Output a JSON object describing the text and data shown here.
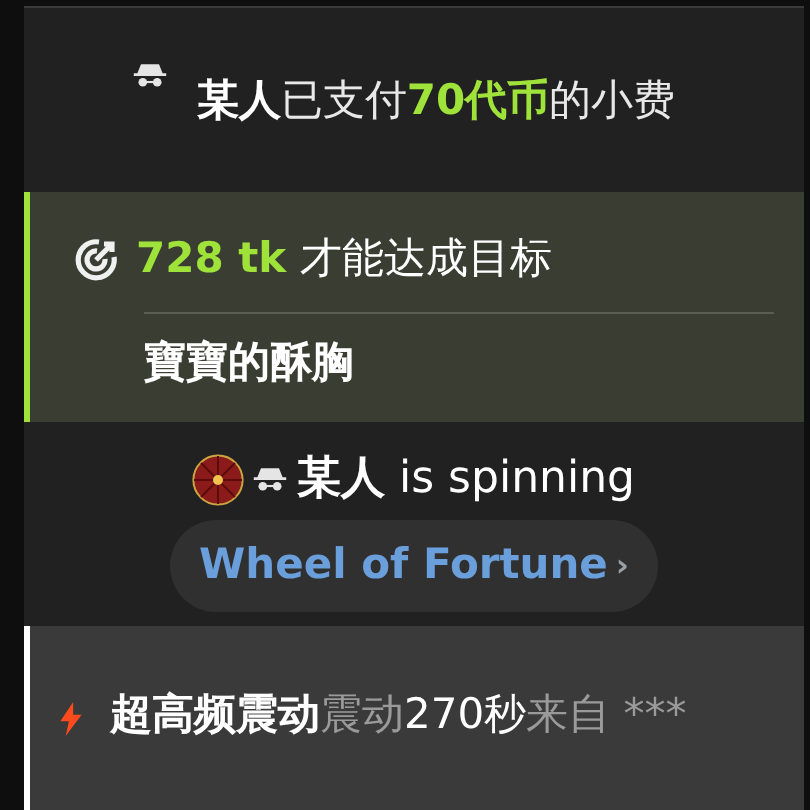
{
  "tip_message": {
    "username": "某人",
    "action": "已支付",
    "amount": "70代币",
    "suffix": "的小费"
  },
  "goal": {
    "amount": "728 tk",
    "text": "才能达成目标",
    "title": "寶寶的酥胸"
  },
  "spin_message": {
    "username": "某人",
    "text": "is spinning",
    "link": "Wheel of Fortune",
    "chevron": "›"
  },
  "vibration": {
    "level_name": "超高频震动",
    "word": "震动",
    "duration": "270秒",
    "from": "来自",
    "sender": "***"
  }
}
